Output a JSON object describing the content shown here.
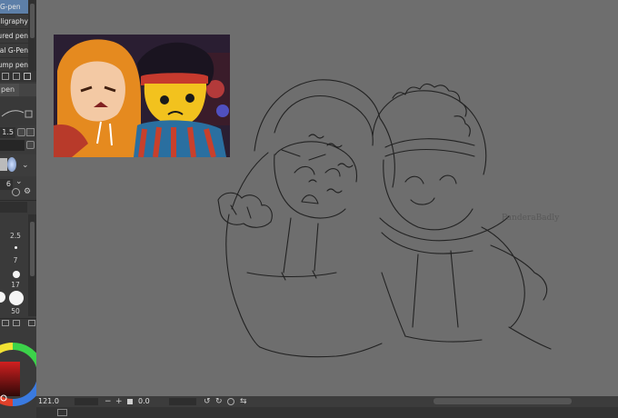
{
  "brush_panel": {
    "items": [
      {
        "label": "G-pen",
        "selected": true
      },
      {
        "label": "calligraphy",
        "selected": false
      },
      {
        "label": "Textured pen",
        "selected": false
      },
      {
        "label": "Real G-Pen",
        "selected": false
      },
      {
        "label": "Bump pen",
        "selected": false
      }
    ]
  },
  "properties": {
    "tab_label": "pen",
    "brush_size": "1.5",
    "opacity": "6"
  },
  "size_palette": {
    "values": [
      "2.5",
      "7",
      "17",
      "50"
    ]
  },
  "status_bar": {
    "zoom": "121.0",
    "minus": "−",
    "plus": "+",
    "angle": "0.0"
  },
  "canvas": {
    "signature": "PanderaBadly"
  },
  "colors": {
    "panel_bg": "#3a3a3a",
    "canvas_bg": "#6e6e6e",
    "selection": "#5d7fa8",
    "orange_hood": "#e58a1f",
    "red_headband": "#c63a2e"
  }
}
